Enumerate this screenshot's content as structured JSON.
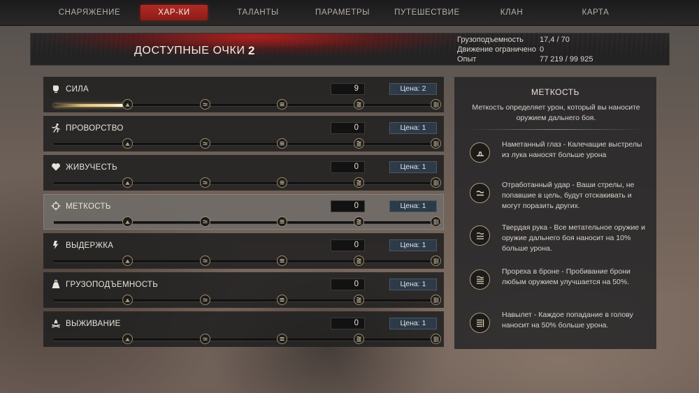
{
  "nav": {
    "tabs": [
      {
        "label": "СНАРЯЖЕНИЕ",
        "active": false
      },
      {
        "label": "ХАР-КИ",
        "active": true
      },
      {
        "label": "ТАЛАНТЫ",
        "active": false
      },
      {
        "label": "ПАРАМЕТРЫ",
        "active": false
      },
      {
        "label": "ПУТЕШЕСТВИЕ",
        "active": false
      },
      {
        "label": "КЛАН",
        "active": false
      },
      {
        "label": "КАРТА",
        "active": false
      }
    ]
  },
  "header": {
    "points_label": "ДОСТУПНЫЕ ОЧКИ",
    "points_value": "2",
    "stats": [
      {
        "label": "Грузоподъемность",
        "value": "17,4 / 70"
      },
      {
        "label": "Движение ограничено",
        "value": "0"
      },
      {
        "label": "Опыт",
        "value": "77 219 / 99 925"
      }
    ]
  },
  "attributes": [
    {
      "name": "СИЛА",
      "icon": "fist-icon",
      "value": "9",
      "cost": "Цена: 2",
      "progress": 0.18,
      "selected": false
    },
    {
      "name": "ПРОВОРСТВО",
      "icon": "runner-icon",
      "value": "0",
      "cost": "Цена: 1",
      "progress": 0,
      "selected": false
    },
    {
      "name": "ЖИВУЧЕСТЬ",
      "icon": "heart-icon",
      "value": "0",
      "cost": "Цена: 1",
      "progress": 0,
      "selected": false
    },
    {
      "name": "МЕТКОСТЬ",
      "icon": "crosshair-icon",
      "value": "0",
      "cost": "Цена: 1",
      "progress": 0,
      "selected": true
    },
    {
      "name": "ВЫДЕРЖКА",
      "icon": "lightning-icon",
      "value": "0",
      "cost": "Цена: 1",
      "progress": 0,
      "selected": false
    },
    {
      "name": "ГРУЗОПОДЪЕМНОСТЬ",
      "icon": "weight-icon",
      "value": "0",
      "cost": "Цена: 1",
      "progress": 0,
      "selected": false
    },
    {
      "name": "ВЫЖИВАНИЕ",
      "icon": "campfire-icon",
      "value": "0",
      "cost": "Цена: 1",
      "progress": 0,
      "selected": false
    }
  ],
  "detail": {
    "title": "МЕТКОСТЬ",
    "description": "Меткость определяет урон, который вы наносите оружием дальнего боя.",
    "perks": [
      {
        "text": "Наметанный глаз - Калечащие выстрелы из лука наносят больше урона",
        "icon": "tier1-rune-icon"
      },
      {
        "text": "Отработанный удар - Ваши стрелы, не попавшие в цель, будут отскакивать и могут поразить других.",
        "icon": "tier2-rune-icon"
      },
      {
        "text": "Твердая рука - Все метательное оружие и оружие дальнего боя наносит на 10% больше урона.",
        "icon": "tier3-rune-icon"
      },
      {
        "text": "Прореха в броне - Пробивание брони любым оружием улучшается на 50%.",
        "icon": "tier4-rune-icon"
      },
      {
        "text": "Навылет - Каждое попадание в голову наносит на 50% больше урона.",
        "icon": "tier5-rune-icon"
      }
    ]
  },
  "colors": {
    "active_tab": "#a82420",
    "selected_row": "#706c68",
    "cost_badge": "#2d3a47",
    "node_ring": "#a08a6a"
  }
}
